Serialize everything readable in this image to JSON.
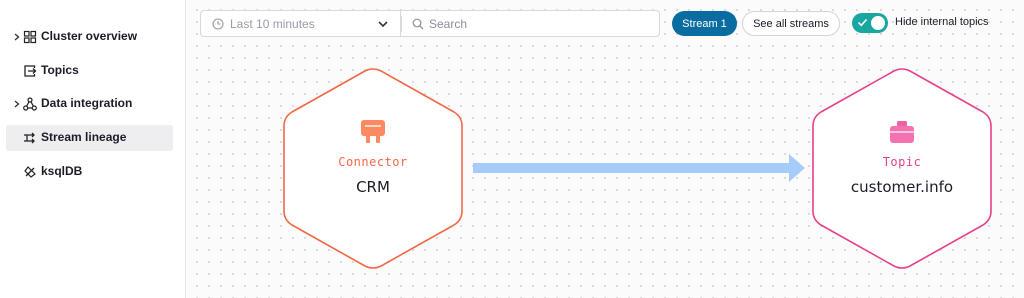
{
  "sidebar": {
    "items": [
      {
        "label": "Cluster overview",
        "icon": "grid-icon",
        "expandable": true,
        "active": false
      },
      {
        "label": "Topics",
        "icon": "topics-icon",
        "expandable": false,
        "active": false
      },
      {
        "label": "Data integration",
        "icon": "network-icon",
        "expandable": true,
        "active": false
      },
      {
        "label": "Stream lineage",
        "icon": "lineage-icon",
        "expandable": false,
        "active": true
      },
      {
        "label": "ksqlDB",
        "icon": "ksqldb-icon",
        "expandable": false,
        "active": false
      }
    ]
  },
  "toolbar": {
    "time_range": "Last 10 minutes",
    "search_placeholder": "Search",
    "stream_button": "Stream 1",
    "all_streams_button": "See all streams",
    "toggle_label": "Hide internal topics",
    "toggle_on": true
  },
  "lineage": {
    "source": {
      "type": "Connector",
      "name": "CRM",
      "color": "#f26846",
      "icon": "plug-icon"
    },
    "target": {
      "type": "Topic",
      "name": "customer.info",
      "color": "#e8408c",
      "icon": "briefcase-icon"
    },
    "edge_color": "#a6ccfa"
  },
  "colors": {
    "accent": "#0a6da2",
    "toggle": "#1aa6a0"
  }
}
